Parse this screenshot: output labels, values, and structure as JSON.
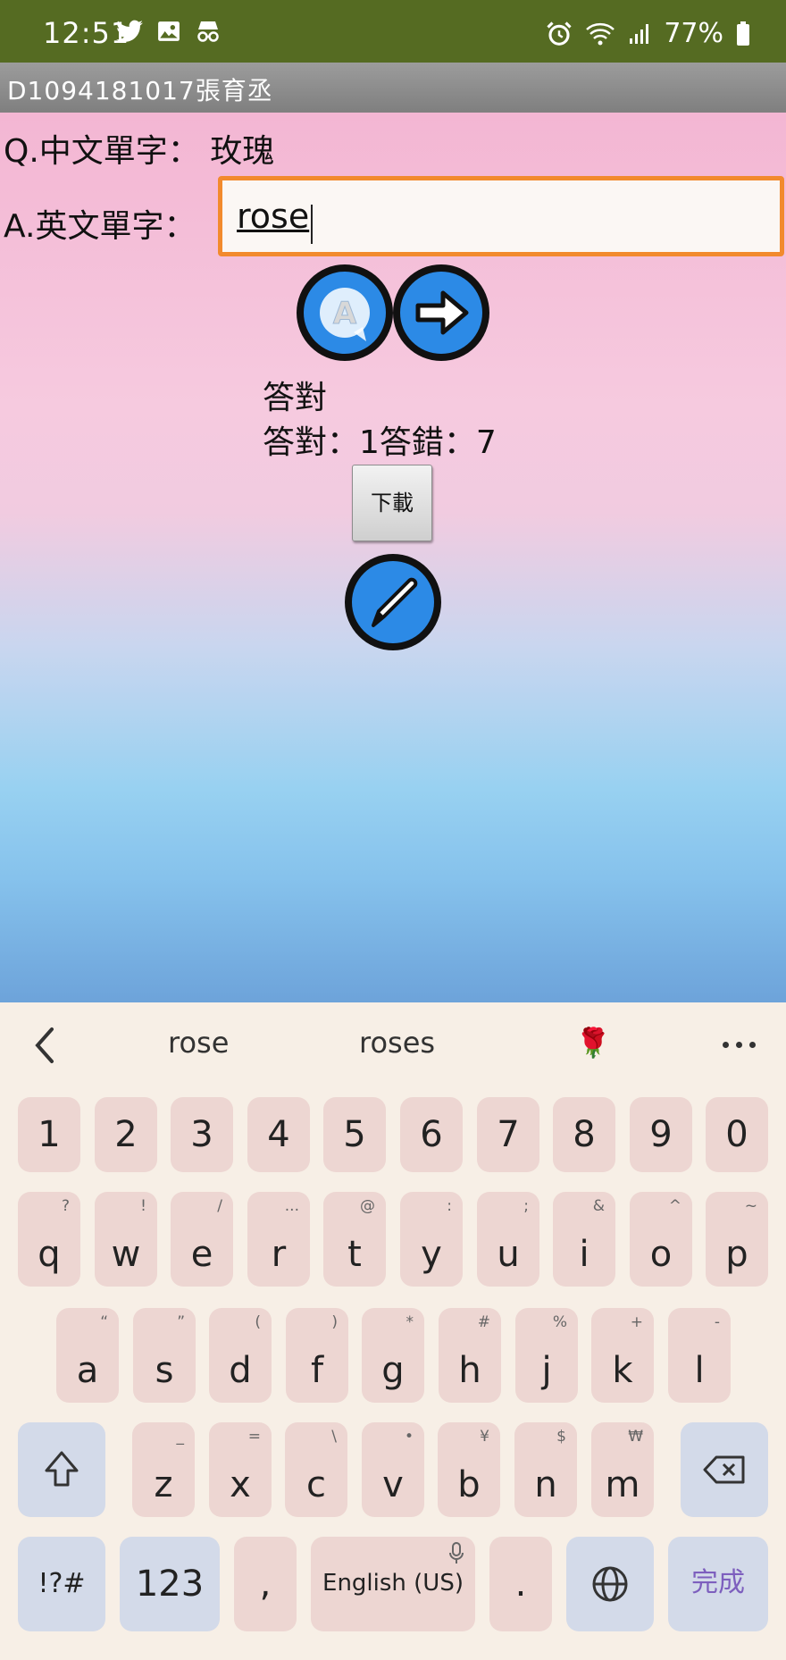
{
  "status_bar": {
    "time": "12:51",
    "battery": "77%",
    "icons": [
      "twitter-icon",
      "image-icon",
      "incognito-icon",
      "alarm-icon",
      "wifi-icon",
      "signal-icon",
      "battery-icon"
    ]
  },
  "app": {
    "title": "D1094181017張育丞"
  },
  "quiz": {
    "question_label": "Q.中文單字：",
    "question_word": "玫瑰",
    "answer_label": "A.英文單字：",
    "answer_value": "rose",
    "result": "答對",
    "score": "答對：1答錯：7",
    "download_label": "下載"
  },
  "keyboard": {
    "suggestions": [
      "rose",
      "roses",
      "🌹"
    ],
    "digits": [
      "1",
      "2",
      "3",
      "4",
      "5",
      "6",
      "7",
      "8",
      "9",
      "0"
    ],
    "row1": [
      {
        "k": "q",
        "h": "?"
      },
      {
        "k": "w",
        "h": "!"
      },
      {
        "k": "e",
        "h": "/"
      },
      {
        "k": "r",
        "h": "..."
      },
      {
        "k": "t",
        "h": "@"
      },
      {
        "k": "y",
        "h": ":"
      },
      {
        "k": "u",
        "h": ";"
      },
      {
        "k": "i",
        "h": "&"
      },
      {
        "k": "o",
        "h": "^"
      },
      {
        "k": "p",
        "h": "~"
      }
    ],
    "row2": [
      {
        "k": "a",
        "h": "“"
      },
      {
        "k": "s",
        "h": "”"
      },
      {
        "k": "d",
        "h": "("
      },
      {
        "k": "f",
        "h": ")"
      },
      {
        "k": "g",
        "h": "*"
      },
      {
        "k": "h",
        "h": "#"
      },
      {
        "k": "j",
        "h": "%"
      },
      {
        "k": "k",
        "h": "+"
      },
      {
        "k": "l",
        "h": "-"
      }
    ],
    "row3": [
      {
        "k": "z",
        "h": "_"
      },
      {
        "k": "x",
        "h": "="
      },
      {
        "k": "c",
        "h": "\\"
      },
      {
        "k": "v",
        "h": "•"
      },
      {
        "k": "b",
        "h": "¥"
      },
      {
        "k": "n",
        "h": "$"
      },
      {
        "k": "m",
        "h": "₩"
      }
    ],
    "symbols_label": "!?#",
    "numbers_label": "123",
    "comma_label": ",",
    "space_label": "English (US)",
    "period_label": ".",
    "done_label": "完成",
    "accent_color": "#7d5fbe"
  }
}
